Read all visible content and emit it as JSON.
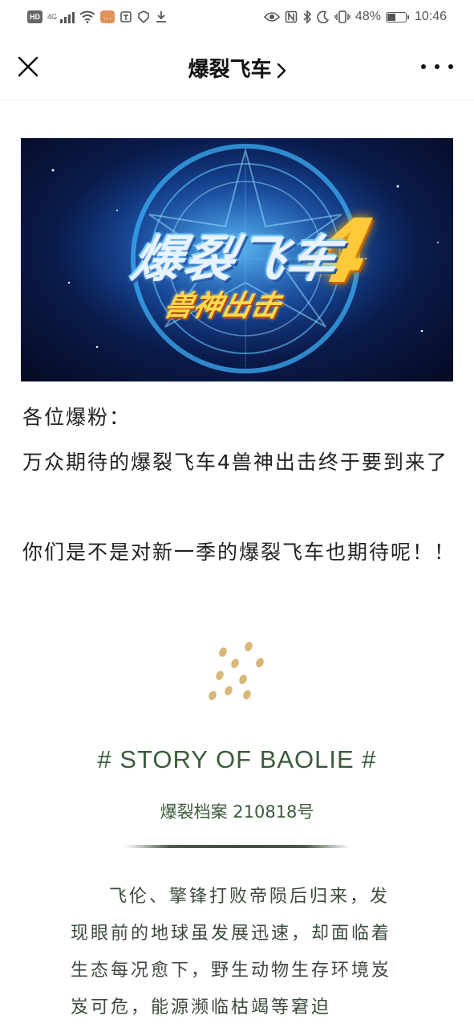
{
  "status_bar": {
    "hd": "HD",
    "network": "4G",
    "battery_percent": "48%",
    "battery_level": 0.48,
    "time": "10:46",
    "left_icons": [
      "hd-badge",
      "signal-icon",
      "wifi-icon",
      "message-icon",
      "app-icon",
      "shield-icon",
      "download-icon"
    ],
    "right_icons": [
      "eye-icon",
      "nfc-icon",
      "bluetooth-icon",
      "moon-icon",
      "vibrate-icon",
      "battery-icon"
    ]
  },
  "nav": {
    "title": "爆裂飞车",
    "close_icon": "close-icon",
    "chevron_icon": "chevron-right-icon",
    "more_icon": "more-icon"
  },
  "banner": {
    "title": "爆裂飞车",
    "number": "4",
    "subtitle": "兽神出击"
  },
  "article": {
    "greeting": "各位爆粉：",
    "line1": "万众期待的爆裂飞车4兽神出击终于要到来了",
    "line2": "你们是不是对新一季的爆裂飞车也期待呢！！"
  },
  "story": {
    "heading": "# STORY OF BAOLIE #",
    "subtitle": "爆裂档案 210818号",
    "body": "飞伦、擎锋打败帝陨后归来，发现眼前的地球虽发展迅速，却面临着生态每况愈下，野生动物生存环境岌岌可危，能源濒临枯竭等窘迫"
  },
  "colors": {
    "story_green": "#3b5a3b",
    "dot_gold": "#d9b679",
    "text": "#222222"
  }
}
